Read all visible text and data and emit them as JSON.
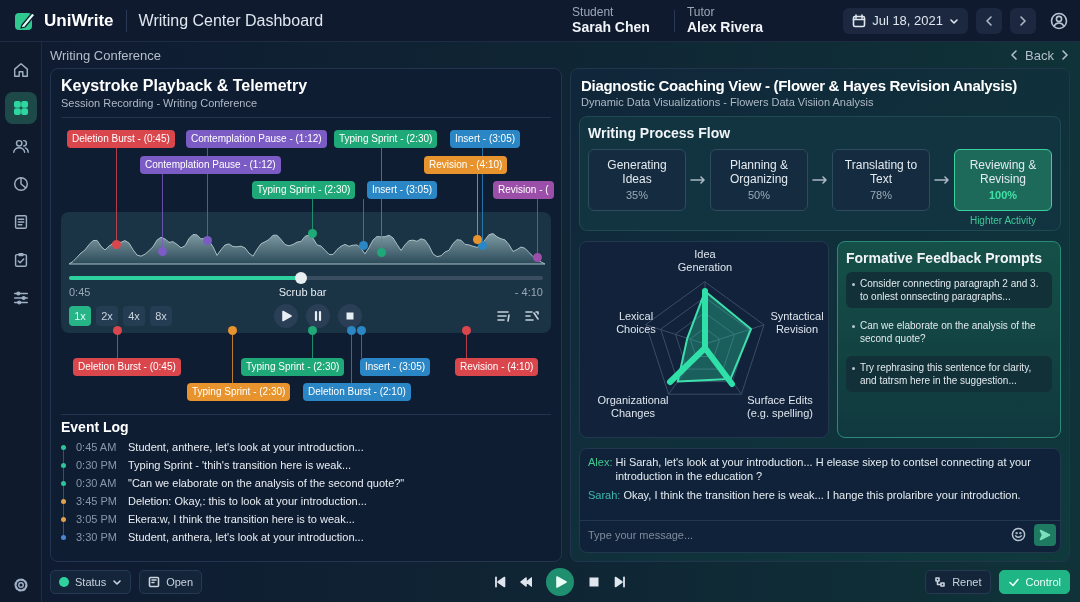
{
  "header": {
    "app_name": "UniWrite",
    "title": "Writing Center Dashboard",
    "student": {
      "label": "Student",
      "name": "Sarah Chen"
    },
    "tutor": {
      "label": "Tutor",
      "name": "Alex Rivera"
    },
    "date": "Jul 18, 2021"
  },
  "sidebar": {
    "items": [
      {
        "selected": false
      },
      {
        "selected": true
      },
      {
        "selected": false
      },
      {
        "selected": false
      },
      {
        "selected": false
      },
      {
        "selected": false
      },
      {
        "selected": false
      }
    ]
  },
  "breadcrumb": "Writing Conference",
  "back": "Back",
  "playback": {
    "title": "Keystroke Playback & Telemetry",
    "subtitle": "Session Recording -  Writing Conference",
    "events_above": [
      {
        "label": "Deletion Burst - (0:45)",
        "color": "#d9474d"
      },
      {
        "label": "Contemplation Pause - (1:12)",
        "color": "#7b5bc4"
      },
      {
        "label": "Typing Sprint - (2:30)",
        "color": "#1fa878"
      },
      {
        "label": "Insert - (3:05)",
        "color": "#2a86c4"
      },
      {
        "label": "Contemplation Pause - (1:12)",
        "color": "#7b5bc4"
      },
      {
        "label": "Revision - (4:10)",
        "color": "#e8942e"
      },
      {
        "label": "Typing Sprint - (2:30)",
        "color": "#1fa878"
      },
      {
        "label": "Insert - (3:05)",
        "color": "#2a86c4"
      },
      {
        "label": "Revision - (",
        "color": "#9b4fa8"
      }
    ],
    "events_below": [
      {
        "label": "Deletion Burst - (0:45)",
        "color": "#d9474d"
      },
      {
        "label": "Typing Sprint - (2:30)",
        "color": "#1fa878"
      },
      {
        "label": "Insert - (3:05)",
        "color": "#2a86c4"
      },
      {
        "label": "Revision - (4:10)",
        "color": "#d9474d"
      },
      {
        "label": "Typing Sprint - (2:30)",
        "color": "#e8942e"
      },
      {
        "label": "Deletion Burst - (2:10)",
        "color": "#2a86c4"
      }
    ],
    "scrub": {
      "level": 0.49,
      "start": "0:45",
      "label": "Scrub bar",
      "end": "- 4:10"
    },
    "speeds": [
      {
        "label": "1x",
        "selected": true
      },
      {
        "label": "2x",
        "selected": false
      },
      {
        "label": "4x",
        "selected": false
      },
      {
        "label": "8x",
        "selected": false
      }
    ]
  },
  "event_log": {
    "title": "Event Log",
    "rows": [
      {
        "time": "0:45 AM",
        "text": "Student, anthere, let's look at your introduction...",
        "color": "#2fc39a"
      },
      {
        "time": "0:30 PM",
        "text": "Typing Sprint - 'thih's transition here is weak...",
        "color": "#2fc39a"
      },
      {
        "time": "0:30 AM",
        "text": "\"Can we elaborate on the analysis of the second quote?\"",
        "color": "#2fc39a"
      },
      {
        "time": "3:45 PM",
        "text": "Deletion:  Okay,: this to look at your introduction...",
        "color": "#e0a24a"
      },
      {
        "time": "3:05 PM",
        "text": "Ekera:w, I think the transition here is to weak...",
        "color": "#e0a24a"
      },
      {
        "time": "3:30 PM",
        "text": "Student, anthera, let's look at your introduction...",
        "color": "#4d86d6"
      }
    ]
  },
  "diagnostic": {
    "title": "Diagnostic Coaching View - (Flower & Hayes Revision Analysis)",
    "subtitle": "Dynamic Data Visualizations - Flowers Data Visiion Analysis",
    "flow": {
      "title": "Writing Process Flow",
      "stages": [
        {
          "label": "Generating Ideas",
          "percent": "35%",
          "selected": false
        },
        {
          "label": "Planning & Organizing",
          "percent": "50%",
          "selected": false
        },
        {
          "label": "Translating to Text",
          "percent": "78%",
          "selected": false
        },
        {
          "label": "Reviewing & Revising",
          "percent": "100%",
          "selected": true
        }
      ],
      "note": "Highter Activity"
    },
    "radar_axes": [
      "Idea Generation",
      "Lexical Choices",
      "Syntactical Revision",
      "Organizational Changes",
      "Surface Edits (e.g. spelling)"
    ],
    "feedback": {
      "title": "Formative Feedback Prompts",
      "prompts": [
        {
          "text": "Consider connecting paragraph 2 and 3. to onlest onnsecting paragraphs...",
          "highlighted": true
        },
        {
          "text": "Can we elaborate on the analysis of the second quote?",
          "highlighted": false
        },
        {
          "text": "Try rephrasing this sentence for clarity, and tatrsm here in the suggestion...",
          "highlighted": true
        }
      ]
    },
    "chat": {
      "messages": [
        {
          "speaker": "Alex:",
          "text": "Hi Sarah, let's look at your introduction... H elease sixep to contsel connecting at your introduction in the education ?",
          "color": "#3ec98f"
        },
        {
          "speaker": "Sarah:",
          "text": "Okay, I think the transition here is weak... I hange this prolaribre your introduction.",
          "color": "#3fb8b0"
        }
      ],
      "placeholder": "Type your message..."
    }
  },
  "bottom_bar": {
    "status": "Status",
    "open": "Open",
    "reset": "Renet",
    "control": "Control"
  }
}
